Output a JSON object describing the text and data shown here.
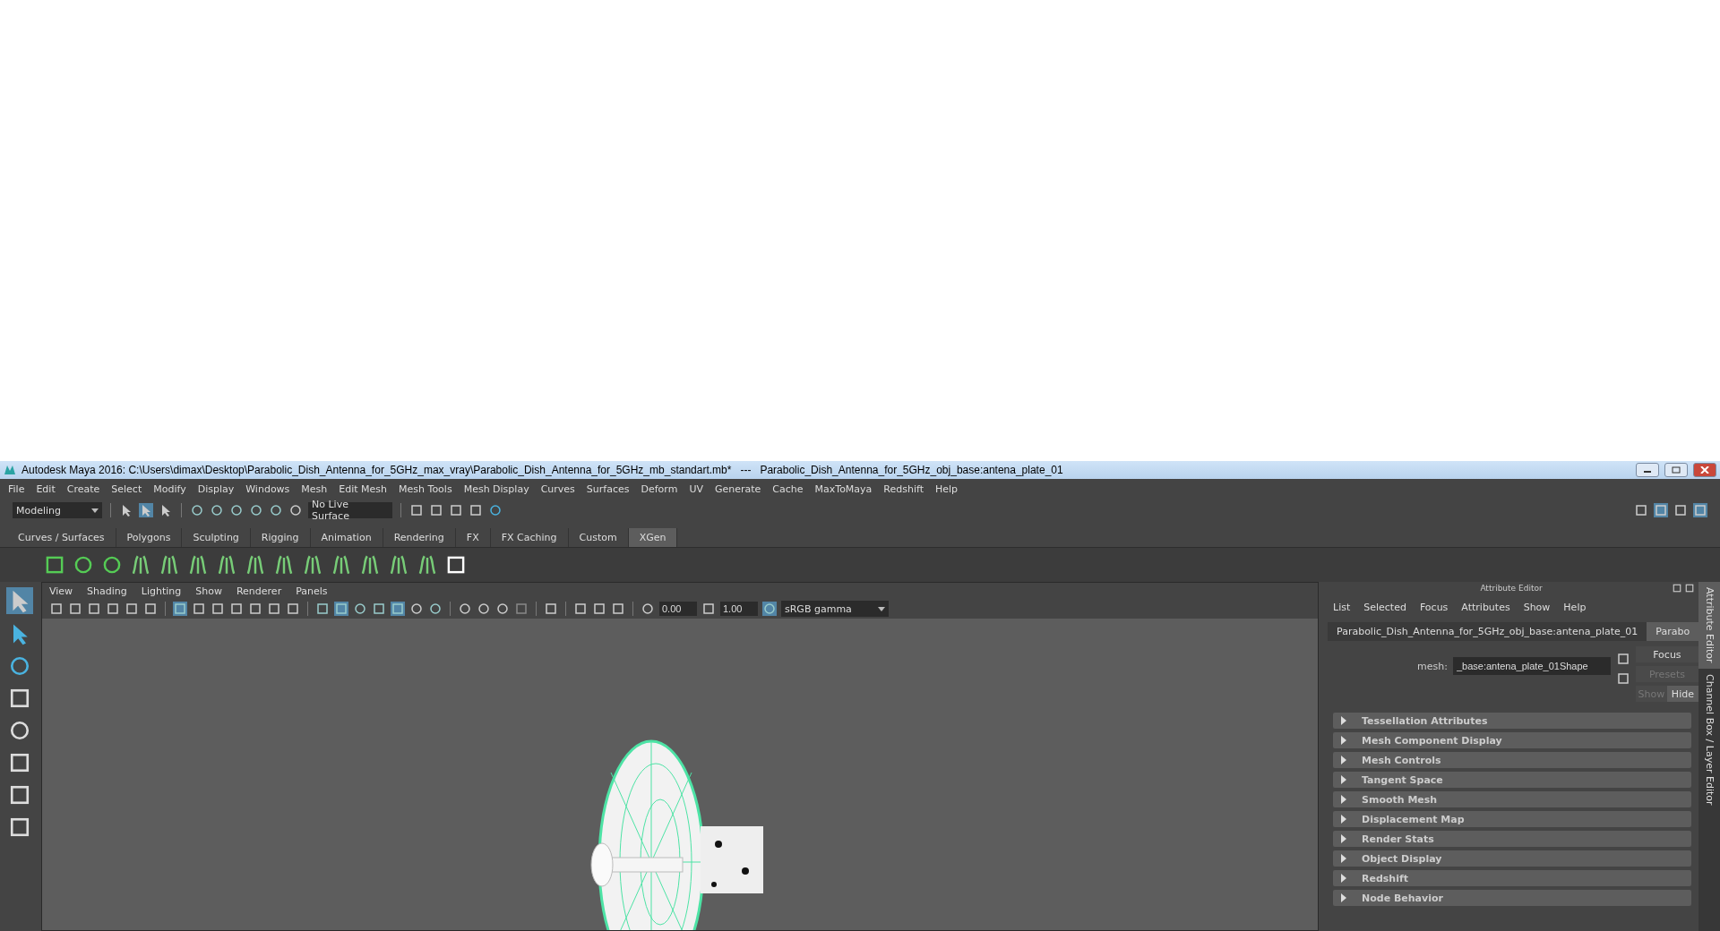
{
  "window": {
    "title": "Autodesk Maya 2016: C:\\Users\\dimax\\Desktop\\Parabolic_Dish_Antenna_for_5GHz_max_vray\\Parabolic_Dish_Antenna_for_5GHz_mb_standart.mb*   ---   Parabolic_Dish_Antenna_for_5GHz_obj_base:antena_plate_01"
  },
  "menu": [
    "File",
    "Edit",
    "Create",
    "Select",
    "Modify",
    "Display",
    "Windows",
    "Mesh",
    "Edit Mesh",
    "Mesh Tools",
    "Mesh Display",
    "Curves",
    "Surfaces",
    "Deform",
    "UV",
    "Generate",
    "Cache",
    "MaxToMaya",
    "Redshift",
    "Help"
  ],
  "status_line": {
    "workspace": "Modeling",
    "live_surface": "No Live Surface"
  },
  "shelf_tabs": [
    {
      "label": "Curves / Surfaces",
      "selected": false
    },
    {
      "label": "Polygons",
      "selected": false
    },
    {
      "label": "Sculpting",
      "selected": false
    },
    {
      "label": "Rigging",
      "selected": false
    },
    {
      "label": "Animation",
      "selected": false
    },
    {
      "label": "Rendering",
      "selected": false
    },
    {
      "label": "FX",
      "selected": false
    },
    {
      "label": "FX Caching",
      "selected": false
    },
    {
      "label": "Custom",
      "selected": false
    },
    {
      "label": "XGen",
      "selected": true
    }
  ],
  "viewport": {
    "menu": [
      "View",
      "Shading",
      "Lighting",
      "Show",
      "Renderer",
      "Panels"
    ],
    "exposure": "0.00",
    "gamma": "1.00",
    "color_space": "sRGB gamma"
  },
  "attribute_editor": {
    "title": "Attribute Editor",
    "menu": [
      "List",
      "Selected",
      "Focus",
      "Attributes",
      "Show",
      "Help"
    ],
    "tabs": [
      {
        "label": "Parabolic_Dish_Antenna_for_5GHz_obj_base:antena_plate_01",
        "selected": false
      },
      {
        "label": "Parabo",
        "selected": true
      }
    ],
    "mesh_label": "mesh:",
    "mesh_value": "_base:antena_plate_01Shape",
    "focus_button": "Focus",
    "presets_button": {
      "label": "Presets",
      "disabled": true
    },
    "show_hide": [
      {
        "label": "Show",
        "selected": false
      },
      {
        "label": "Hide",
        "selected": true
      }
    ],
    "sections": [
      {
        "label": "Tessellation Attributes",
        "expanded": false
      },
      {
        "label": "Mesh Component Display",
        "expanded": false
      },
      {
        "label": "Mesh Controls",
        "expanded": false
      },
      {
        "label": "Tangent Space",
        "expanded": false
      },
      {
        "label": "Smooth Mesh",
        "expanded": false
      },
      {
        "label": "Displacement Map",
        "expanded": false
      },
      {
        "label": "Render Stats",
        "expanded": false
      },
      {
        "label": "Object Display",
        "expanded": false
      },
      {
        "label": "Redshift",
        "expanded": false
      },
      {
        "label": "Node Behavior",
        "expanded": false
      }
    ]
  },
  "side_tabs": [
    {
      "label": "Attribute Editor",
      "selected": true
    },
    {
      "label": "Channel Box / Layer Editor",
      "selected": false
    }
  ]
}
